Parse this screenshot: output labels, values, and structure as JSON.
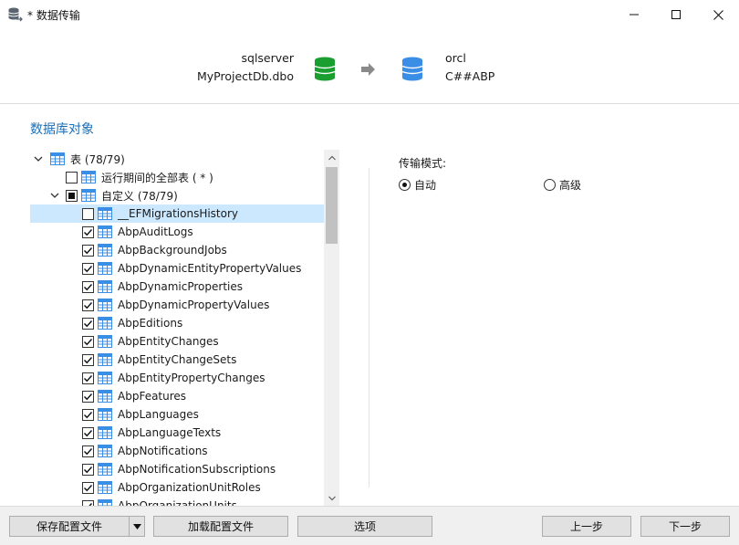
{
  "window": {
    "title": "* 数据传输"
  },
  "header": {
    "source": {
      "server": "sqlserver",
      "schema": "MyProjectDb.dbo"
    },
    "target": {
      "server": "orcl",
      "schema": "C##ABP"
    },
    "colors": {
      "source_db": "#1a9e2f",
      "target_db": "#3a8ee6",
      "arrow": "#8a8a8a"
    }
  },
  "section_title": "数据库对象",
  "tree": {
    "root": {
      "label": "表 (78/79)"
    },
    "runtime": {
      "label": "运行期间的全部表 ( * )"
    },
    "custom": {
      "label": "自定义 (78/79)"
    },
    "tables": [
      {
        "name": "__EFMigrationsHistory",
        "checked": false
      },
      {
        "name": "AbpAuditLogs",
        "checked": true
      },
      {
        "name": "AbpBackgroundJobs",
        "checked": true
      },
      {
        "name": "AbpDynamicEntityPropertyValues",
        "checked": true
      },
      {
        "name": "AbpDynamicProperties",
        "checked": true
      },
      {
        "name": "AbpDynamicPropertyValues",
        "checked": true
      },
      {
        "name": "AbpEditions",
        "checked": true
      },
      {
        "name": "AbpEntityChanges",
        "checked": true
      },
      {
        "name": "AbpEntityChangeSets",
        "checked": true
      },
      {
        "name": "AbpEntityPropertyChanges",
        "checked": true
      },
      {
        "name": "AbpFeatures",
        "checked": true
      },
      {
        "name": "AbpLanguages",
        "checked": true
      },
      {
        "name": "AbpLanguageTexts",
        "checked": true
      },
      {
        "name": "AbpNotifications",
        "checked": true
      },
      {
        "name": "AbpNotificationSubscriptions",
        "checked": true
      },
      {
        "name": "AbpOrganizationUnitRoles",
        "checked": true
      },
      {
        "name": "AbpOrganizationUnits",
        "checked": true
      }
    ],
    "selected_color": "#cce8ff"
  },
  "transfer": {
    "mode_label": "传输模式:",
    "options": [
      {
        "label": "自动",
        "selected": true
      },
      {
        "label": "高级",
        "selected": false
      }
    ]
  },
  "footer": {
    "save_config": "保存配置文件",
    "load_config": "加载配置文件",
    "options": "选项",
    "prev": "上一步",
    "next": "下一步"
  }
}
